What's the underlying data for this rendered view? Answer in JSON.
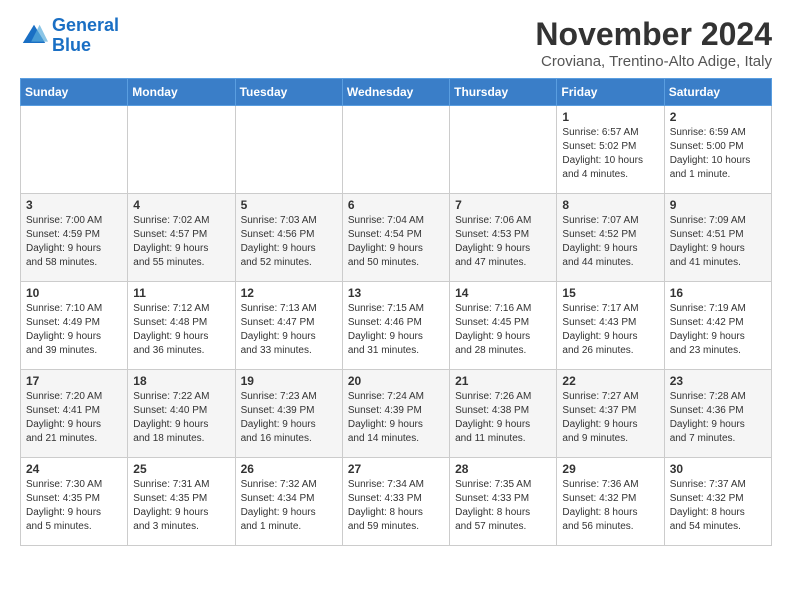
{
  "header": {
    "logo_line1": "General",
    "logo_line2": "Blue",
    "month": "November 2024",
    "location": "Croviana, Trentino-Alto Adige, Italy"
  },
  "days_of_week": [
    "Sunday",
    "Monday",
    "Tuesday",
    "Wednesday",
    "Thursday",
    "Friday",
    "Saturday"
  ],
  "weeks": [
    [
      {
        "day": "",
        "info": ""
      },
      {
        "day": "",
        "info": ""
      },
      {
        "day": "",
        "info": ""
      },
      {
        "day": "",
        "info": ""
      },
      {
        "day": "",
        "info": ""
      },
      {
        "day": "1",
        "info": "Sunrise: 6:57 AM\nSunset: 5:02 PM\nDaylight: 10 hours\nand 4 minutes."
      },
      {
        "day": "2",
        "info": "Sunrise: 6:59 AM\nSunset: 5:00 PM\nDaylight: 10 hours\nand 1 minute."
      }
    ],
    [
      {
        "day": "3",
        "info": "Sunrise: 7:00 AM\nSunset: 4:59 PM\nDaylight: 9 hours\nand 58 minutes."
      },
      {
        "day": "4",
        "info": "Sunrise: 7:02 AM\nSunset: 4:57 PM\nDaylight: 9 hours\nand 55 minutes."
      },
      {
        "day": "5",
        "info": "Sunrise: 7:03 AM\nSunset: 4:56 PM\nDaylight: 9 hours\nand 52 minutes."
      },
      {
        "day": "6",
        "info": "Sunrise: 7:04 AM\nSunset: 4:54 PM\nDaylight: 9 hours\nand 50 minutes."
      },
      {
        "day": "7",
        "info": "Sunrise: 7:06 AM\nSunset: 4:53 PM\nDaylight: 9 hours\nand 47 minutes."
      },
      {
        "day": "8",
        "info": "Sunrise: 7:07 AM\nSunset: 4:52 PM\nDaylight: 9 hours\nand 44 minutes."
      },
      {
        "day": "9",
        "info": "Sunrise: 7:09 AM\nSunset: 4:51 PM\nDaylight: 9 hours\nand 41 minutes."
      }
    ],
    [
      {
        "day": "10",
        "info": "Sunrise: 7:10 AM\nSunset: 4:49 PM\nDaylight: 9 hours\nand 39 minutes."
      },
      {
        "day": "11",
        "info": "Sunrise: 7:12 AM\nSunset: 4:48 PM\nDaylight: 9 hours\nand 36 minutes."
      },
      {
        "day": "12",
        "info": "Sunrise: 7:13 AM\nSunset: 4:47 PM\nDaylight: 9 hours\nand 33 minutes."
      },
      {
        "day": "13",
        "info": "Sunrise: 7:15 AM\nSunset: 4:46 PM\nDaylight: 9 hours\nand 31 minutes."
      },
      {
        "day": "14",
        "info": "Sunrise: 7:16 AM\nSunset: 4:45 PM\nDaylight: 9 hours\nand 28 minutes."
      },
      {
        "day": "15",
        "info": "Sunrise: 7:17 AM\nSunset: 4:43 PM\nDaylight: 9 hours\nand 26 minutes."
      },
      {
        "day": "16",
        "info": "Sunrise: 7:19 AM\nSunset: 4:42 PM\nDaylight: 9 hours\nand 23 minutes."
      }
    ],
    [
      {
        "day": "17",
        "info": "Sunrise: 7:20 AM\nSunset: 4:41 PM\nDaylight: 9 hours\nand 21 minutes."
      },
      {
        "day": "18",
        "info": "Sunrise: 7:22 AM\nSunset: 4:40 PM\nDaylight: 9 hours\nand 18 minutes."
      },
      {
        "day": "19",
        "info": "Sunrise: 7:23 AM\nSunset: 4:39 PM\nDaylight: 9 hours\nand 16 minutes."
      },
      {
        "day": "20",
        "info": "Sunrise: 7:24 AM\nSunset: 4:39 PM\nDaylight: 9 hours\nand 14 minutes."
      },
      {
        "day": "21",
        "info": "Sunrise: 7:26 AM\nSunset: 4:38 PM\nDaylight: 9 hours\nand 11 minutes."
      },
      {
        "day": "22",
        "info": "Sunrise: 7:27 AM\nSunset: 4:37 PM\nDaylight: 9 hours\nand 9 minutes."
      },
      {
        "day": "23",
        "info": "Sunrise: 7:28 AM\nSunset: 4:36 PM\nDaylight: 9 hours\nand 7 minutes."
      }
    ],
    [
      {
        "day": "24",
        "info": "Sunrise: 7:30 AM\nSunset: 4:35 PM\nDaylight: 9 hours\nand 5 minutes."
      },
      {
        "day": "25",
        "info": "Sunrise: 7:31 AM\nSunset: 4:35 PM\nDaylight: 9 hours\nand 3 minutes."
      },
      {
        "day": "26",
        "info": "Sunrise: 7:32 AM\nSunset: 4:34 PM\nDaylight: 9 hours\nand 1 minute."
      },
      {
        "day": "27",
        "info": "Sunrise: 7:34 AM\nSunset: 4:33 PM\nDaylight: 8 hours\nand 59 minutes."
      },
      {
        "day": "28",
        "info": "Sunrise: 7:35 AM\nSunset: 4:33 PM\nDaylight: 8 hours\nand 57 minutes."
      },
      {
        "day": "29",
        "info": "Sunrise: 7:36 AM\nSunset: 4:32 PM\nDaylight: 8 hours\nand 56 minutes."
      },
      {
        "day": "30",
        "info": "Sunrise: 7:37 AM\nSunset: 4:32 PM\nDaylight: 8 hours\nand 54 minutes."
      }
    ]
  ]
}
